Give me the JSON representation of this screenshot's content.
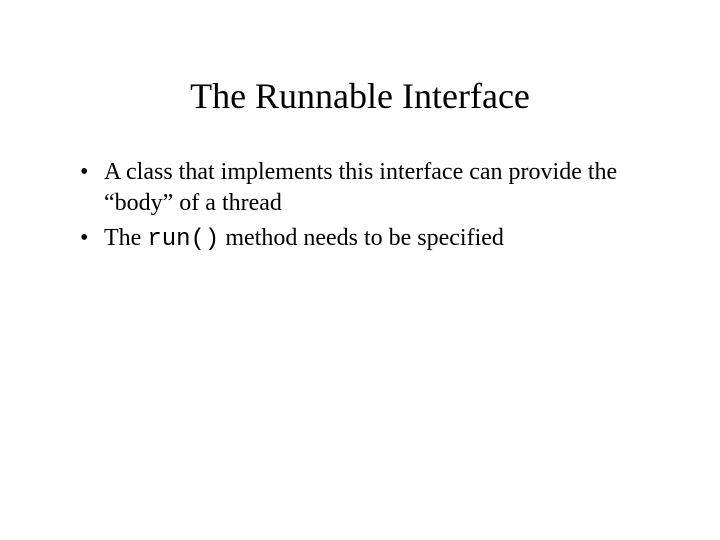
{
  "title": "The Runnable Interface",
  "bullets": [
    {
      "text": "A class that implements this interface can provide the “body” of a thread"
    },
    {
      "prefix": "The ",
      "code": "run()",
      "suffix": " method needs to be specified"
    }
  ]
}
